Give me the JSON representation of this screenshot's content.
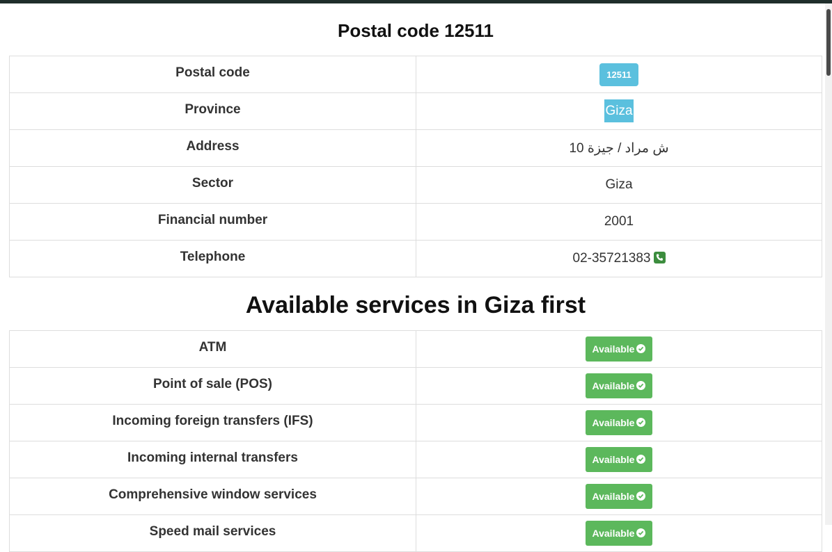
{
  "title": "Postal code 12511",
  "info": [
    {
      "label": "Postal code",
      "value": "12511",
      "style": "badge"
    },
    {
      "label": "Province",
      "value": "Giza",
      "style": "highlight"
    },
    {
      "label": "Address",
      "value": "ش مراد / جيزة 10",
      "style": "rtl"
    },
    {
      "label": "Sector",
      "value": "Giza",
      "style": "plain"
    },
    {
      "label": "Financial number",
      "value": "2001",
      "style": "plain"
    },
    {
      "label": "Telephone",
      "value": "02-35721383",
      "style": "phone"
    }
  ],
  "services_title": "Available services in Giza first",
  "services": [
    {
      "name": "ATM",
      "status": "Available"
    },
    {
      "name": "Point of sale (POS)",
      "status": "Available"
    },
    {
      "name": "Incoming foreign transfers (IFS)",
      "status": "Available"
    },
    {
      "name": "Incoming internal transfers",
      "status": "Available"
    },
    {
      "name": "Comprehensive window services",
      "status": "Available"
    },
    {
      "name": "Speed mail services",
      "status": "Available"
    }
  ],
  "colors": {
    "badge": "#5bc0de",
    "available": "#5cb85c",
    "phone_icon": "#3c8d3e",
    "top_bar": "#1f2e2b"
  },
  "icons": {
    "phone": "phone-square-icon",
    "available": "check-circle-icon"
  }
}
